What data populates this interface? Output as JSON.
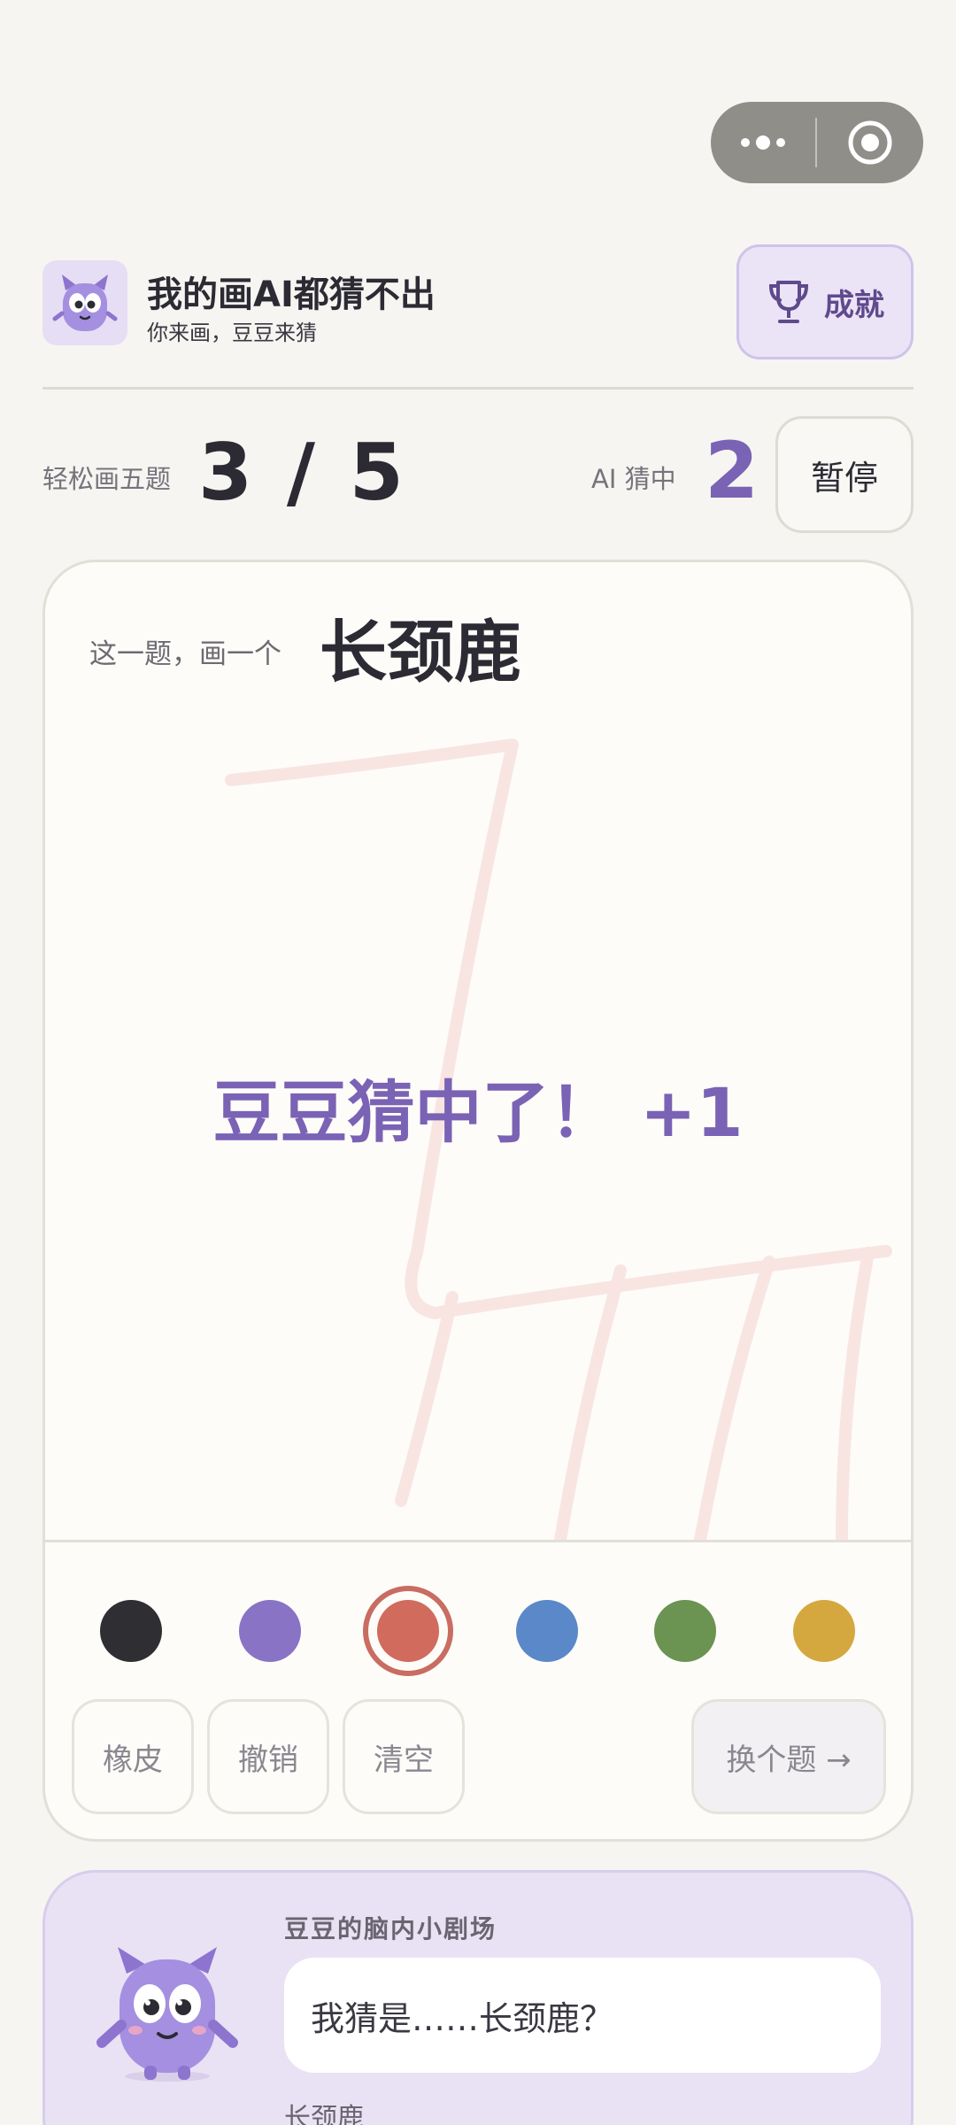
{
  "header": {
    "title": "我的画AI都猜不出",
    "subtitle": "你来画，豆豆来猜",
    "achievement_label": "成就"
  },
  "progress": {
    "mode_label": "轻松画五题",
    "count": "3 / 5",
    "current_round": 3,
    "total_rounds": 5,
    "ai_label": "AI 猜中",
    "ai_correct": "2",
    "pause_label": "暂停"
  },
  "canvas": {
    "prompt_prefix": "这一题，画一个",
    "prompt_word": "长颈鹿",
    "guess_banner": "豆豆猜中了！ +1",
    "stroke_color": "#f8e5e2"
  },
  "palette": {
    "colors": [
      "#2f2f33",
      "#8873c5",
      "#d06b5e",
      "#5a88c8",
      "#6b9352",
      "#d4a83f"
    ],
    "selected_color": "#d06b5e"
  },
  "tools": {
    "eraser_label": "橡皮",
    "undo_label": "撤销",
    "clear_label": "清空",
    "skip_label": "换个题 →"
  },
  "thought": {
    "title": "豆豆的脑内小剧场",
    "bubble_text": "我猜是……长颈鹿？",
    "answer": "长颈鹿"
  },
  "colors": {
    "accent": "#7a62b5",
    "background": "#f6f5f1",
    "card": "#fdfcf8",
    "panel": "#e9e2f4"
  },
  "icons": {
    "capsule_more": "more-dots-icon",
    "capsule_close": "target-close-icon",
    "achievement": "trophy-icon",
    "logo": "mascot-logo-icon"
  }
}
